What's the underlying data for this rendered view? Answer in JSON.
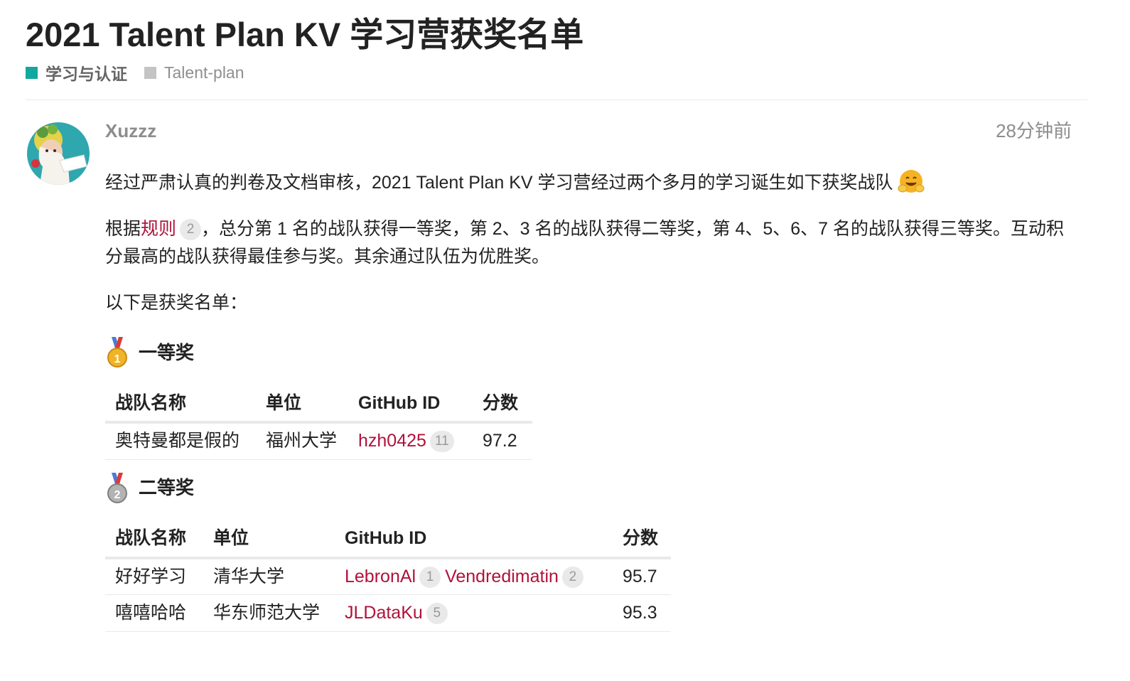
{
  "topic": {
    "title": "2021 Talent Plan KV 学习营获奖名单",
    "category": {
      "label": "学习与认证",
      "color": "#12a89d"
    },
    "subcategory": {
      "label": "Talent-plan",
      "color": "#b3b5b4"
    }
  },
  "post": {
    "username": "Xuzzz",
    "date": "28分钟前",
    "intro": "经过严肃认真的判卷及文档审核，2021 Talent Plan KV 学习营经过两个多月的学习诞生如下获奖战队",
    "intro_emoji": "hugging-face-emoji",
    "rules_prefix": "根据",
    "rules_link": "规则",
    "rules_clicks": "2",
    "rules_suffix": "，总分第 1 名的战队获得一等奖，第 2、3 名的战队获得二等奖，第 4、5、6、7 名的战队获得三等奖。互动积分最高的战队获得最佳参与奖。其余通过队伍为优胜奖。",
    "list_intro": "以下是获奖名单："
  },
  "prizes": [
    {
      "title": "一等奖",
      "medal": "gold-medal-icon",
      "medal_number": "1",
      "headers": [
        "战队名称",
        "单位",
        "GitHub ID",
        "分数"
      ],
      "rows": [
        {
          "team": "奥特曼都是假的",
          "org": "福州大学",
          "ids": [
            {
              "name": "hzh0425",
              "clicks": "11"
            }
          ],
          "score": "97.2"
        }
      ]
    },
    {
      "title": "二等奖",
      "medal": "silver-medal-icon",
      "medal_number": "2",
      "headers": [
        "战队名称",
        "单位",
        "GitHub ID",
        "分数"
      ],
      "rows": [
        {
          "team": "好好学习",
          "org": "清华大学",
          "ids": [
            {
              "name": "LebronAl",
              "clicks": "1"
            },
            {
              "name": "Vendredimatin",
              "clicks": "2"
            }
          ],
          "score": "95.7"
        },
        {
          "team": "嘻嘻哈哈",
          "org": "华东师范大学",
          "ids": [
            {
              "name": "JLDataKu",
              "clicks": "5"
            }
          ],
          "score": "95.3"
        }
      ]
    }
  ],
  "colors": {
    "link": "#b0123a",
    "divider": "#e9e9e9",
    "meta": "#8d8d8d"
  }
}
